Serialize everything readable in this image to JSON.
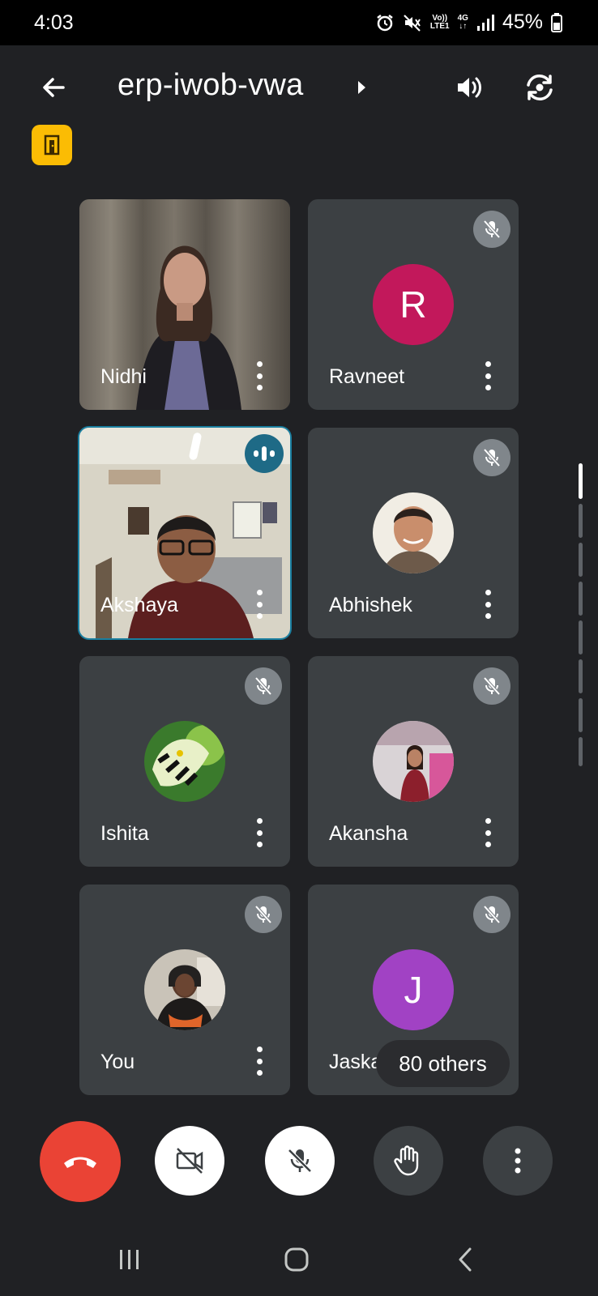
{
  "status_bar": {
    "time": "4:03",
    "volte": "Vo))",
    "lte": "LTE1",
    "network": "4G",
    "battery": "45%"
  },
  "header": {
    "meeting_code": "erp-iwob-vwa",
    "icons": [
      "back-arrow-icon",
      "speaker-icon",
      "switch-camera-icon",
      "host-controls-icon"
    ]
  },
  "participants": [
    {
      "name": "Nidhi",
      "type": "video",
      "muted": false
    },
    {
      "name": "Ravneet",
      "type": "initial",
      "initial": "R",
      "avatar_color": "#c2185b",
      "muted": true
    },
    {
      "name": "Akshaya",
      "type": "video",
      "muted": false,
      "speaking": true
    },
    {
      "name": "Abhishek",
      "type": "photo",
      "muted": true
    },
    {
      "name": "Ishita",
      "type": "photo",
      "muted": true
    },
    {
      "name": "Akansha",
      "type": "photo",
      "muted": true
    },
    {
      "name": "You",
      "type": "photo",
      "muted": true
    },
    {
      "name": "Jaskaran",
      "type": "initial",
      "initial": "J",
      "avatar_color": "#a142c4",
      "muted": true
    }
  ],
  "others_pill": "80 others",
  "controls": [
    "end-call-button",
    "camera-toggle-button",
    "mic-toggle-button",
    "raise-hand-button",
    "more-options-button"
  ],
  "colors": {
    "background": "#202124",
    "tile": "#3c4043",
    "end_call": "#ea4335",
    "speaking_outline": "#1a7fa0",
    "host_badge": "#fbbc04"
  }
}
